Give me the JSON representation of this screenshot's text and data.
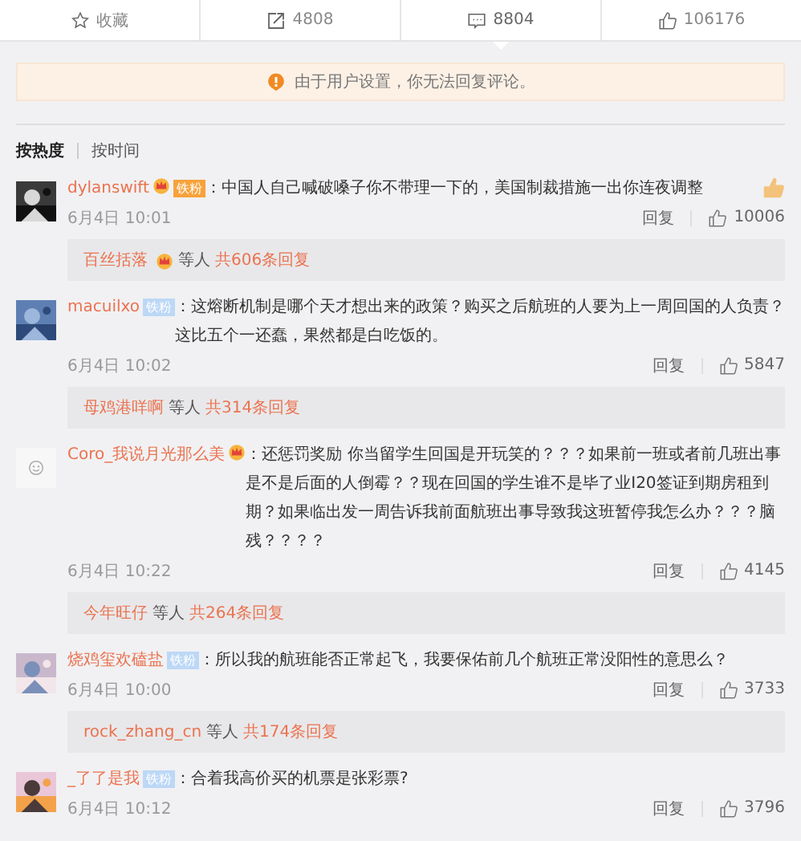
{
  "action_bar": [
    {
      "kind": "star",
      "label": "收藏",
      "selected": false
    },
    {
      "kind": "share",
      "label": "4808",
      "selected": false
    },
    {
      "kind": "comment",
      "label": "8804",
      "selected": true
    },
    {
      "kind": "like",
      "label": "106176",
      "selected": false
    }
  ],
  "notice": "由于用户设置，你无法回复评论。",
  "sort_tabs": [
    {
      "label": "按热度",
      "selected": true
    },
    {
      "label": "按时间",
      "selected": false
    }
  ],
  "comments": [
    {
      "name": "dylanswift",
      "badge": {
        "kind": "crown_fan",
        "label": "铁粉"
      },
      "text": "：中国人自己喊破嗓子你不带理一下的，美国制裁措施一出你连夜调整",
      "emoji": {
        "kind": "thumbs_up"
      },
      "time": "6月4日 10:01",
      "reply": "回复",
      "likes": "10006",
      "replies": {
        "name": "百丝括落",
        "crown": true,
        "others": "等人",
        "count": "共606条回复"
      }
    },
    {
      "name": "macuilxo",
      "badge": {
        "kind": "fan",
        "label": "铁粉"
      },
      "text": "：这熔断机制是哪个天才想出来的政策？购买之后航班的人要为上一周回国的人负责？这比五个一还蠢，果然都是白吃饭的。",
      "time": "6月4日 10:02",
      "reply": "回复",
      "likes": "5847",
      "replies": {
        "name": "母鸡港咩啊",
        "crown": false,
        "others": "等人",
        "count": "共314条回复"
      }
    },
    {
      "avatar": {
        "kind": "default"
      },
      "name": "Coro_我说月光那么美",
      "badge": {
        "kind": "crown"
      },
      "text": "：还惩罚奖励 你当留学生回国是开玩笑的？？？如果前一班或者前几班出事是不是后面的人倒霉？？现在回国的学生谁不是毕了业I20签证到期房租到期？如果临出发一周告诉我前面航班出事导致我这班暂停我怎么办？？？脑残？？？？",
      "time": "6月4日 10:22",
      "reply": "回复",
      "likes": "4145",
      "replies": {
        "name": "今年旺仔",
        "crown": false,
        "others": "等人",
        "count": "共264条回复"
      }
    },
    {
      "name": "烧鸡玺欢磕盐",
      "badge": {
        "kind": "fan",
        "label": "铁粉"
      },
      "text": "：所以我的航班能否正常起飞，我要保佑前几个航班正常没阳性的意思么？",
      "time": "6月4日 10:00",
      "reply": "回复",
      "likes": "3733",
      "replies": {
        "name": "rock_zhang_cn",
        "crown": false,
        "others": "等人",
        "count": "共174条回复"
      }
    },
    {
      "name": "_了了是我",
      "badge": {
        "kind": "fan",
        "label": "铁粉"
      },
      "text": "：合着我高价买的机票是张彩票?",
      "time": "6月4日 10:12",
      "reply": "回复",
      "likes": "3796"
    }
  ]
}
